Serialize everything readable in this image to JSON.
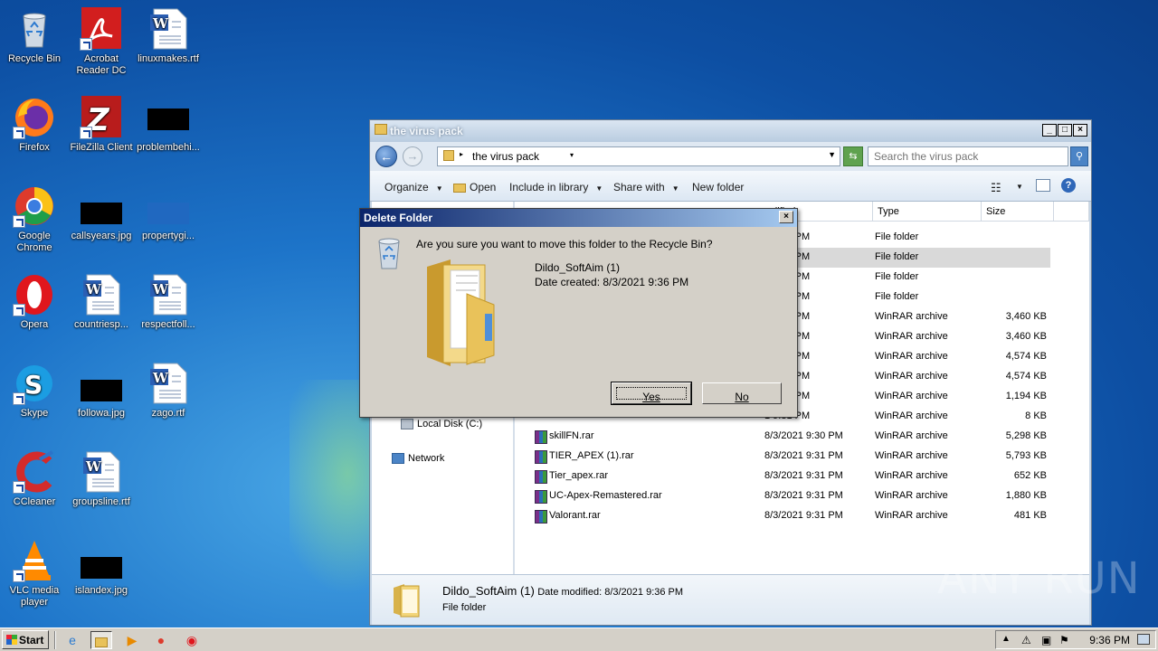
{
  "desktop": {
    "icons": [
      {
        "label": "Recycle Bin"
      },
      {
        "label": "Acrobat Reader DC"
      },
      {
        "label": "linuxmakes.rtf"
      },
      {
        "label": "Firefox"
      },
      {
        "label": "FileZilla Client"
      },
      {
        "label": "problembehi..."
      },
      {
        "label": "Google Chrome"
      },
      {
        "label": "callsyears.jpg"
      },
      {
        "label": "propertygi..."
      },
      {
        "label": "Opera"
      },
      {
        "label": "countriesp..."
      },
      {
        "label": "respectfoll..."
      },
      {
        "label": "Skype"
      },
      {
        "label": "followa.jpg"
      },
      {
        "label": "zago.rtf"
      },
      {
        "label": "CCleaner"
      },
      {
        "label": "groupsline.rtf"
      },
      {
        "label": "VLC media player"
      },
      {
        "label": "islandex.jpg"
      }
    ]
  },
  "explorer": {
    "title": "the virus pack",
    "breadcrumb": "the virus pack",
    "search_placeholder": "Search the virus pack",
    "toolbar": {
      "organize": "Organize",
      "open": "Open",
      "include": "Include in library",
      "share": "Share with",
      "new_folder": "New folder"
    },
    "columns": {
      "modified": "odified",
      "type": "Type",
      "size": "Size"
    },
    "nav": {
      "local_disk": "Local Disk (C:)",
      "network": "Network"
    },
    "rows": [
      {
        "name": "",
        "date": "1 9:36 PM",
        "type": "File folder",
        "size": ""
      },
      {
        "name": "",
        "date": "1 9:36 PM",
        "type": "File folder",
        "size": ""
      },
      {
        "name": "",
        "date": "1 9:36 PM",
        "type": "File folder",
        "size": ""
      },
      {
        "name": "",
        "date": "1 9:36 PM",
        "type": "File folder",
        "size": ""
      },
      {
        "name": "",
        "date": "1 9:30 PM",
        "type": "WinRAR archive",
        "size": "3,460 KB"
      },
      {
        "name": "",
        "date": "1 9:30 PM",
        "type": "WinRAR archive",
        "size": "3,460 KB"
      },
      {
        "name": "",
        "date": "1 9:30 PM",
        "type": "WinRAR archive",
        "size": "4,574 KB"
      },
      {
        "name": "",
        "date": "1 9:30 PM",
        "type": "WinRAR archive",
        "size": "4,574 KB"
      },
      {
        "name": "",
        "date": "1 9:31 PM",
        "type": "WinRAR archive",
        "size": "1,194 KB"
      },
      {
        "name": "",
        "date": "1 9:31 PM",
        "type": "WinRAR archive",
        "size": "8 KB"
      },
      {
        "name": "skillFN.rar",
        "date": "8/3/2021 9:30 PM",
        "type": "WinRAR archive",
        "size": "5,298 KB"
      },
      {
        "name": "TIER_APEX (1).rar",
        "date": "8/3/2021 9:31 PM",
        "type": "WinRAR archive",
        "size": "5,793 KB"
      },
      {
        "name": "Tier_apex.rar",
        "date": "8/3/2021 9:31 PM",
        "type": "WinRAR archive",
        "size": "652 KB"
      },
      {
        "name": "UC-Apex-Remastered.rar",
        "date": "8/3/2021 9:31 PM",
        "type": "WinRAR archive",
        "size": "1,880 KB"
      },
      {
        "name": "Valorant.rar",
        "date": "8/3/2021 9:31 PM",
        "type": "WinRAR archive",
        "size": "481 KB"
      }
    ],
    "details": {
      "name": "Dildo_SoftAim (1)",
      "modified": "Date modified: 8/3/2021 9:36 PM",
      "type": "File folder"
    }
  },
  "dialog": {
    "title": "Delete Folder",
    "message": "Are you sure you want to move this folder to the Recycle Bin?",
    "folder_name": "Dildo_SoftAim (1)",
    "folder_date": "Date created: 8/3/2021 9:36 PM",
    "yes": "Yes",
    "no": "No"
  },
  "taskbar": {
    "start": "Start",
    "clock": "9:36 PM"
  },
  "watermark": "ANY RUN",
  "colors": {
    "desktop_bg": "#1d74c9",
    "dialog_title": "#0a246a",
    "selected_row": "#d9d9d9"
  }
}
